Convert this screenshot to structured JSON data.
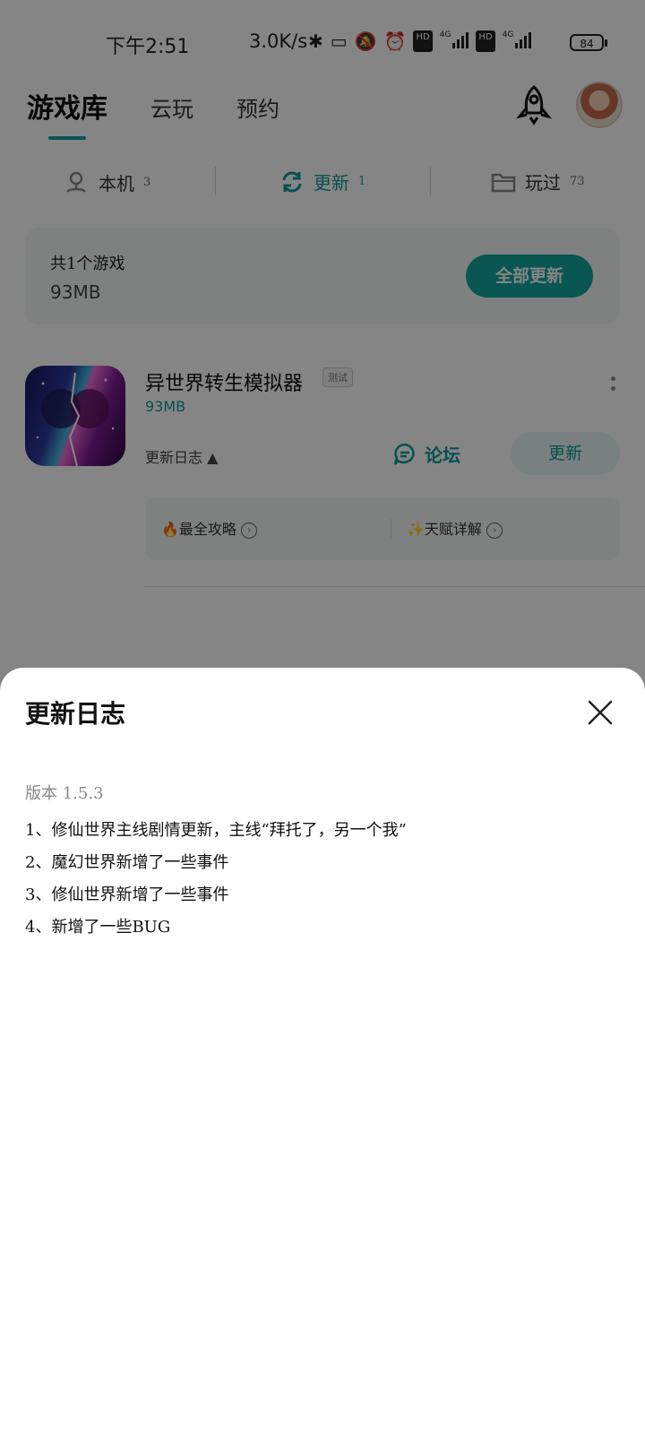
{
  "status_bar": {
    "time": "下午2:51",
    "network_speed": "3.0K/s",
    "signal_label_1": "4G",
    "signal_label_2": "4G",
    "hd_label": "HD",
    "battery": "84"
  },
  "header": {
    "tabs": [
      {
        "label": "游戏库",
        "active": true
      },
      {
        "label": "云玩"
      },
      {
        "label": "预约"
      }
    ]
  },
  "subtabs": [
    {
      "label": "本机",
      "count": "3"
    },
    {
      "label": "更新",
      "count": "1",
      "active": true
    },
    {
      "label": "玩过",
      "count": "73"
    }
  ],
  "summary": {
    "count_text": "共1个游戏",
    "size": "93MB",
    "update_all_label": "全部更新"
  },
  "game": {
    "title": "异世界转生模拟器",
    "badge": "测试",
    "size": "93MB",
    "changelog_label": "更新日志 ▲",
    "forum_label": "论坛",
    "update_label": "更新",
    "guides": [
      "🔥最全攻略",
      "✨天赋详解"
    ]
  },
  "sheet": {
    "title": "更新日志",
    "version": "版本 1.5.3",
    "lines": [
      "1、修仙世界主线剧情更新，主线“拜托了，另一个我”",
      "2、魔幻世界新增了一些事件",
      "3、修仙世界新增了一些事件",
      "4、新增了一些BUG"
    ]
  },
  "colors": {
    "accent": "#13a5a0",
    "accent_light": "#e6f6f5",
    "overlay": "rgba(0,0,0,0.48)"
  }
}
